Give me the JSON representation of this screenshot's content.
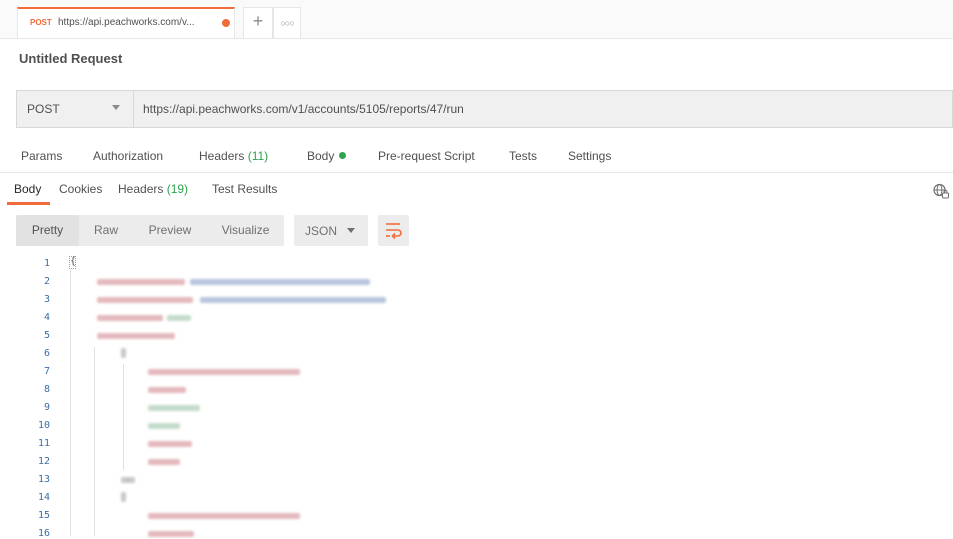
{
  "tab": {
    "method": "POST",
    "url": "https://api.peachworks.com/v..."
  },
  "request": {
    "title": "Untitled Request",
    "method": "POST",
    "url": "https://api.peachworks.com/v1/accounts/5105/reports/47/run"
  },
  "request_tabs": {
    "params": "Params",
    "authorization": "Authorization",
    "headers_label": "Headers",
    "headers_count": "(11)",
    "body": "Body",
    "prerequest": "Pre-request Script",
    "tests": "Tests",
    "settings": "Settings"
  },
  "response_tabs": {
    "body": "Body",
    "cookies": "Cookies",
    "headers_label": "Headers",
    "headers_count": "(19)",
    "test_results": "Test Results"
  },
  "view_options": {
    "pretty": "Pretty",
    "raw": "Raw",
    "preview": "Preview",
    "visualize": "Visualize",
    "format": "JSON"
  },
  "code": {
    "first_line": "{",
    "line_numbers": [
      "1",
      "2",
      "3",
      "4",
      "5",
      "6",
      "7",
      "8",
      "9",
      "10",
      "11",
      "12",
      "13",
      "14",
      "15",
      "16"
    ]
  },
  "colors": {
    "accent": "#f26b3a",
    "status_green": "#2da44e"
  }
}
